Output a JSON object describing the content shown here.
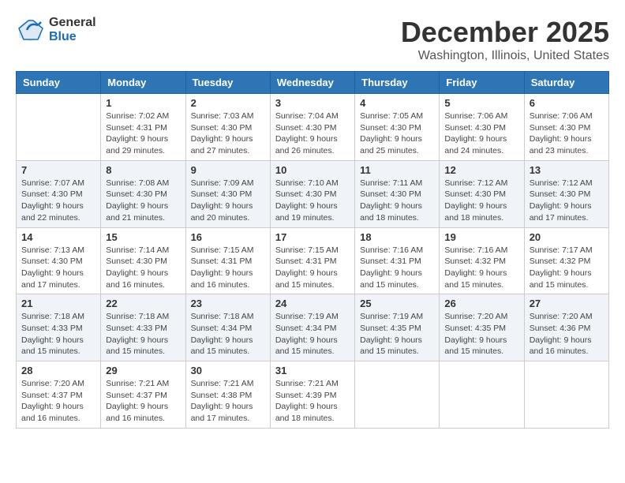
{
  "header": {
    "logo_general": "General",
    "logo_blue": "Blue",
    "month": "December 2025",
    "location": "Washington, Illinois, United States"
  },
  "columns": [
    "Sunday",
    "Monday",
    "Tuesday",
    "Wednesday",
    "Thursday",
    "Friday",
    "Saturday"
  ],
  "weeks": [
    [
      {
        "day": "",
        "sunrise": "",
        "sunset": "",
        "daylight": ""
      },
      {
        "day": "1",
        "sunrise": "Sunrise: 7:02 AM",
        "sunset": "Sunset: 4:31 PM",
        "daylight": "Daylight: 9 hours and 29 minutes."
      },
      {
        "day": "2",
        "sunrise": "Sunrise: 7:03 AM",
        "sunset": "Sunset: 4:30 PM",
        "daylight": "Daylight: 9 hours and 27 minutes."
      },
      {
        "day": "3",
        "sunrise": "Sunrise: 7:04 AM",
        "sunset": "Sunset: 4:30 PM",
        "daylight": "Daylight: 9 hours and 26 minutes."
      },
      {
        "day": "4",
        "sunrise": "Sunrise: 7:05 AM",
        "sunset": "Sunset: 4:30 PM",
        "daylight": "Daylight: 9 hours and 25 minutes."
      },
      {
        "day": "5",
        "sunrise": "Sunrise: 7:06 AM",
        "sunset": "Sunset: 4:30 PM",
        "daylight": "Daylight: 9 hours and 24 minutes."
      },
      {
        "day": "6",
        "sunrise": "Sunrise: 7:06 AM",
        "sunset": "Sunset: 4:30 PM",
        "daylight": "Daylight: 9 hours and 23 minutes."
      }
    ],
    [
      {
        "day": "7",
        "sunrise": "Sunrise: 7:07 AM",
        "sunset": "Sunset: 4:30 PM",
        "daylight": "Daylight: 9 hours and 22 minutes."
      },
      {
        "day": "8",
        "sunrise": "Sunrise: 7:08 AM",
        "sunset": "Sunset: 4:30 PM",
        "daylight": "Daylight: 9 hours and 21 minutes."
      },
      {
        "day": "9",
        "sunrise": "Sunrise: 7:09 AM",
        "sunset": "Sunset: 4:30 PM",
        "daylight": "Daylight: 9 hours and 20 minutes."
      },
      {
        "day": "10",
        "sunrise": "Sunrise: 7:10 AM",
        "sunset": "Sunset: 4:30 PM",
        "daylight": "Daylight: 9 hours and 19 minutes."
      },
      {
        "day": "11",
        "sunrise": "Sunrise: 7:11 AM",
        "sunset": "Sunset: 4:30 PM",
        "daylight": "Daylight: 9 hours and 18 minutes."
      },
      {
        "day": "12",
        "sunrise": "Sunrise: 7:12 AM",
        "sunset": "Sunset: 4:30 PM",
        "daylight": "Daylight: 9 hours and 18 minutes."
      },
      {
        "day": "13",
        "sunrise": "Sunrise: 7:12 AM",
        "sunset": "Sunset: 4:30 PM",
        "daylight": "Daylight: 9 hours and 17 minutes."
      }
    ],
    [
      {
        "day": "14",
        "sunrise": "Sunrise: 7:13 AM",
        "sunset": "Sunset: 4:30 PM",
        "daylight": "Daylight: 9 hours and 17 minutes."
      },
      {
        "day": "15",
        "sunrise": "Sunrise: 7:14 AM",
        "sunset": "Sunset: 4:30 PM",
        "daylight": "Daylight: 9 hours and 16 minutes."
      },
      {
        "day": "16",
        "sunrise": "Sunrise: 7:15 AM",
        "sunset": "Sunset: 4:31 PM",
        "daylight": "Daylight: 9 hours and 16 minutes."
      },
      {
        "day": "17",
        "sunrise": "Sunrise: 7:15 AM",
        "sunset": "Sunset: 4:31 PM",
        "daylight": "Daylight: 9 hours and 15 minutes."
      },
      {
        "day": "18",
        "sunrise": "Sunrise: 7:16 AM",
        "sunset": "Sunset: 4:31 PM",
        "daylight": "Daylight: 9 hours and 15 minutes."
      },
      {
        "day": "19",
        "sunrise": "Sunrise: 7:16 AM",
        "sunset": "Sunset: 4:32 PM",
        "daylight": "Daylight: 9 hours and 15 minutes."
      },
      {
        "day": "20",
        "sunrise": "Sunrise: 7:17 AM",
        "sunset": "Sunset: 4:32 PM",
        "daylight": "Daylight: 9 hours and 15 minutes."
      }
    ],
    [
      {
        "day": "21",
        "sunrise": "Sunrise: 7:18 AM",
        "sunset": "Sunset: 4:33 PM",
        "daylight": "Daylight: 9 hours and 15 minutes."
      },
      {
        "day": "22",
        "sunrise": "Sunrise: 7:18 AM",
        "sunset": "Sunset: 4:33 PM",
        "daylight": "Daylight: 9 hours and 15 minutes."
      },
      {
        "day": "23",
        "sunrise": "Sunrise: 7:18 AM",
        "sunset": "Sunset: 4:34 PM",
        "daylight": "Daylight: 9 hours and 15 minutes."
      },
      {
        "day": "24",
        "sunrise": "Sunrise: 7:19 AM",
        "sunset": "Sunset: 4:34 PM",
        "daylight": "Daylight: 9 hours and 15 minutes."
      },
      {
        "day": "25",
        "sunrise": "Sunrise: 7:19 AM",
        "sunset": "Sunset: 4:35 PM",
        "daylight": "Daylight: 9 hours and 15 minutes."
      },
      {
        "day": "26",
        "sunrise": "Sunrise: 7:20 AM",
        "sunset": "Sunset: 4:35 PM",
        "daylight": "Daylight: 9 hours and 15 minutes."
      },
      {
        "day": "27",
        "sunrise": "Sunrise: 7:20 AM",
        "sunset": "Sunset: 4:36 PM",
        "daylight": "Daylight: 9 hours and 16 minutes."
      }
    ],
    [
      {
        "day": "28",
        "sunrise": "Sunrise: 7:20 AM",
        "sunset": "Sunset: 4:37 PM",
        "daylight": "Daylight: 9 hours and 16 minutes."
      },
      {
        "day": "29",
        "sunrise": "Sunrise: 7:21 AM",
        "sunset": "Sunset: 4:37 PM",
        "daylight": "Daylight: 9 hours and 16 minutes."
      },
      {
        "day": "30",
        "sunrise": "Sunrise: 7:21 AM",
        "sunset": "Sunset: 4:38 PM",
        "daylight": "Daylight: 9 hours and 17 minutes."
      },
      {
        "day": "31",
        "sunrise": "Sunrise: 7:21 AM",
        "sunset": "Sunset: 4:39 PM",
        "daylight": "Daylight: 9 hours and 18 minutes."
      },
      {
        "day": "",
        "sunrise": "",
        "sunset": "",
        "daylight": ""
      },
      {
        "day": "",
        "sunrise": "",
        "sunset": "",
        "daylight": ""
      },
      {
        "day": "",
        "sunrise": "",
        "sunset": "",
        "daylight": ""
      }
    ]
  ]
}
